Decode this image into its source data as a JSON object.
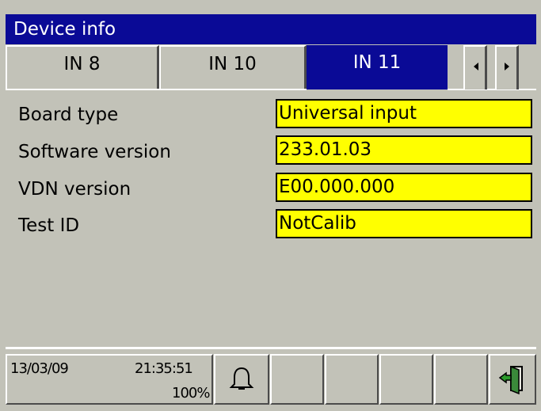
{
  "window": {
    "title": "Device info"
  },
  "tabs": [
    {
      "label": "IN 8"
    },
    {
      "label": "IN 10"
    },
    {
      "label": "IN 11",
      "active": true
    }
  ],
  "nav": {
    "prev_icon": "arrow-left-icon",
    "next_icon": "arrow-right-icon"
  },
  "fields": [
    {
      "label": "Board type",
      "value": "Universal input"
    },
    {
      "label": "Software version",
      "value": "233.01.03"
    },
    {
      "label": "VDN version",
      "value": "E00.000.000"
    },
    {
      "label": "Test ID",
      "value": "NotCalib"
    }
  ],
  "status": {
    "date": "13/03/09",
    "time": "21:35:51",
    "zoom": "100%",
    "alarm_icon": "bell-icon",
    "exit_icon": "exit-door-icon"
  },
  "colors": {
    "title_bar": "#0a0a96",
    "background": "#c2c2b8",
    "value_field": "#ffff00"
  }
}
